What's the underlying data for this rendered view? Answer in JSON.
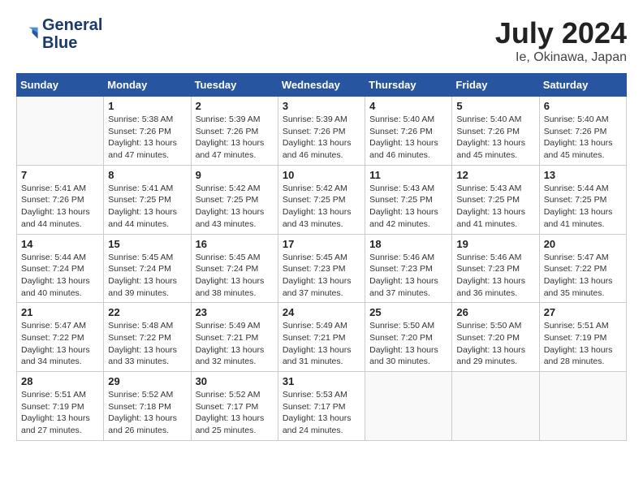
{
  "header": {
    "logo_line1": "General",
    "logo_line2": "Blue",
    "month": "July 2024",
    "location": "Ie, Okinawa, Japan"
  },
  "weekdays": [
    "Sunday",
    "Monday",
    "Tuesday",
    "Wednesday",
    "Thursday",
    "Friday",
    "Saturday"
  ],
  "weeks": [
    [
      {
        "day": "",
        "info": ""
      },
      {
        "day": "1",
        "info": "Sunrise: 5:38 AM\nSunset: 7:26 PM\nDaylight: 13 hours\nand 47 minutes."
      },
      {
        "day": "2",
        "info": "Sunrise: 5:39 AM\nSunset: 7:26 PM\nDaylight: 13 hours\nand 47 minutes."
      },
      {
        "day": "3",
        "info": "Sunrise: 5:39 AM\nSunset: 7:26 PM\nDaylight: 13 hours\nand 46 minutes."
      },
      {
        "day": "4",
        "info": "Sunrise: 5:40 AM\nSunset: 7:26 PM\nDaylight: 13 hours\nand 46 minutes."
      },
      {
        "day": "5",
        "info": "Sunrise: 5:40 AM\nSunset: 7:26 PM\nDaylight: 13 hours\nand 45 minutes."
      },
      {
        "day": "6",
        "info": "Sunrise: 5:40 AM\nSunset: 7:26 PM\nDaylight: 13 hours\nand 45 minutes."
      }
    ],
    [
      {
        "day": "7",
        "info": "Sunrise: 5:41 AM\nSunset: 7:26 PM\nDaylight: 13 hours\nand 44 minutes."
      },
      {
        "day": "8",
        "info": "Sunrise: 5:41 AM\nSunset: 7:25 PM\nDaylight: 13 hours\nand 44 minutes."
      },
      {
        "day": "9",
        "info": "Sunrise: 5:42 AM\nSunset: 7:25 PM\nDaylight: 13 hours\nand 43 minutes."
      },
      {
        "day": "10",
        "info": "Sunrise: 5:42 AM\nSunset: 7:25 PM\nDaylight: 13 hours\nand 43 minutes."
      },
      {
        "day": "11",
        "info": "Sunrise: 5:43 AM\nSunset: 7:25 PM\nDaylight: 13 hours\nand 42 minutes."
      },
      {
        "day": "12",
        "info": "Sunrise: 5:43 AM\nSunset: 7:25 PM\nDaylight: 13 hours\nand 41 minutes."
      },
      {
        "day": "13",
        "info": "Sunrise: 5:44 AM\nSunset: 7:25 PM\nDaylight: 13 hours\nand 41 minutes."
      }
    ],
    [
      {
        "day": "14",
        "info": "Sunrise: 5:44 AM\nSunset: 7:24 PM\nDaylight: 13 hours\nand 40 minutes."
      },
      {
        "day": "15",
        "info": "Sunrise: 5:45 AM\nSunset: 7:24 PM\nDaylight: 13 hours\nand 39 minutes."
      },
      {
        "day": "16",
        "info": "Sunrise: 5:45 AM\nSunset: 7:24 PM\nDaylight: 13 hours\nand 38 minutes."
      },
      {
        "day": "17",
        "info": "Sunrise: 5:45 AM\nSunset: 7:23 PM\nDaylight: 13 hours\nand 37 minutes."
      },
      {
        "day": "18",
        "info": "Sunrise: 5:46 AM\nSunset: 7:23 PM\nDaylight: 13 hours\nand 37 minutes."
      },
      {
        "day": "19",
        "info": "Sunrise: 5:46 AM\nSunset: 7:23 PM\nDaylight: 13 hours\nand 36 minutes."
      },
      {
        "day": "20",
        "info": "Sunrise: 5:47 AM\nSunset: 7:22 PM\nDaylight: 13 hours\nand 35 minutes."
      }
    ],
    [
      {
        "day": "21",
        "info": "Sunrise: 5:47 AM\nSunset: 7:22 PM\nDaylight: 13 hours\nand 34 minutes."
      },
      {
        "day": "22",
        "info": "Sunrise: 5:48 AM\nSunset: 7:22 PM\nDaylight: 13 hours\nand 33 minutes."
      },
      {
        "day": "23",
        "info": "Sunrise: 5:49 AM\nSunset: 7:21 PM\nDaylight: 13 hours\nand 32 minutes."
      },
      {
        "day": "24",
        "info": "Sunrise: 5:49 AM\nSunset: 7:21 PM\nDaylight: 13 hours\nand 31 minutes."
      },
      {
        "day": "25",
        "info": "Sunrise: 5:50 AM\nSunset: 7:20 PM\nDaylight: 13 hours\nand 30 minutes."
      },
      {
        "day": "26",
        "info": "Sunrise: 5:50 AM\nSunset: 7:20 PM\nDaylight: 13 hours\nand 29 minutes."
      },
      {
        "day": "27",
        "info": "Sunrise: 5:51 AM\nSunset: 7:19 PM\nDaylight: 13 hours\nand 28 minutes."
      }
    ],
    [
      {
        "day": "28",
        "info": "Sunrise: 5:51 AM\nSunset: 7:19 PM\nDaylight: 13 hours\nand 27 minutes."
      },
      {
        "day": "29",
        "info": "Sunrise: 5:52 AM\nSunset: 7:18 PM\nDaylight: 13 hours\nand 26 minutes."
      },
      {
        "day": "30",
        "info": "Sunrise: 5:52 AM\nSunset: 7:17 PM\nDaylight: 13 hours\nand 25 minutes."
      },
      {
        "day": "31",
        "info": "Sunrise: 5:53 AM\nSunset: 7:17 PM\nDaylight: 13 hours\nand 24 minutes."
      },
      {
        "day": "",
        "info": ""
      },
      {
        "day": "",
        "info": ""
      },
      {
        "day": "",
        "info": ""
      }
    ]
  ]
}
